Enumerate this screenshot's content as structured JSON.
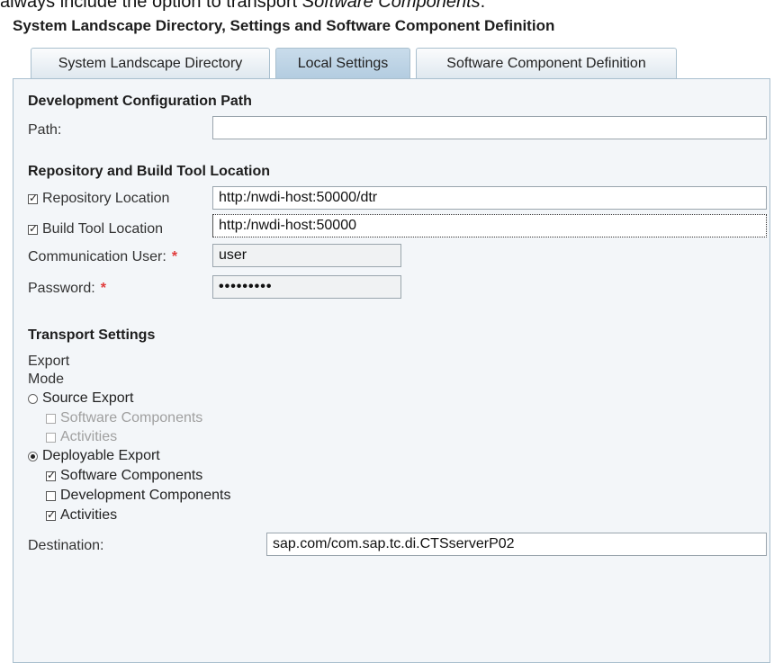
{
  "intro_text": "always include the option to transport",
  "intro_italic": "Software Components",
  "intro_end": ".",
  "title": "System Landscape Directory, Settings and Software Component Definition",
  "tabs": [
    {
      "label": "System Landscape Directory",
      "active": false
    },
    {
      "label": "Local Settings",
      "active": true
    },
    {
      "label": "Software Component Definition",
      "active": false
    }
  ],
  "dev_config": {
    "heading": "Development Configuration Path",
    "path_label": "Path:",
    "path_value": ""
  },
  "repo": {
    "heading": "Repository and Build Tool Location",
    "repo_label": "Repository Location",
    "repo_checked": true,
    "repo_value": "http:/nwdi-host:50000/dtr",
    "build_label": "Build Tool Location",
    "build_checked": true,
    "build_value": "http:/nwdi-host:50000",
    "user_label": "Communication User:",
    "user_value": "user",
    "password_label": "Password:",
    "password_value": "•••••••••",
    "required_mark": "*"
  },
  "transport": {
    "heading": "Transport Settings",
    "export_label": "Export",
    "mode_label": "Mode",
    "source_export": {
      "label": "Source Export",
      "selected": false,
      "options": [
        {
          "label": "Software Components",
          "checked": false,
          "disabled": true
        },
        {
          "label": "Activities",
          "checked": false,
          "disabled": true
        }
      ]
    },
    "deployable_export": {
      "label": "Deployable Export",
      "selected": true,
      "options": [
        {
          "label": "Software Components",
          "checked": true,
          "disabled": false
        },
        {
          "label": "Development Components",
          "checked": false,
          "disabled": false
        },
        {
          "label": "Activities",
          "checked": true,
          "disabled": false
        }
      ]
    },
    "destination_label": "Destination:",
    "destination_value": "sap.com/com.sap.tc.di.CTSserverP02"
  }
}
